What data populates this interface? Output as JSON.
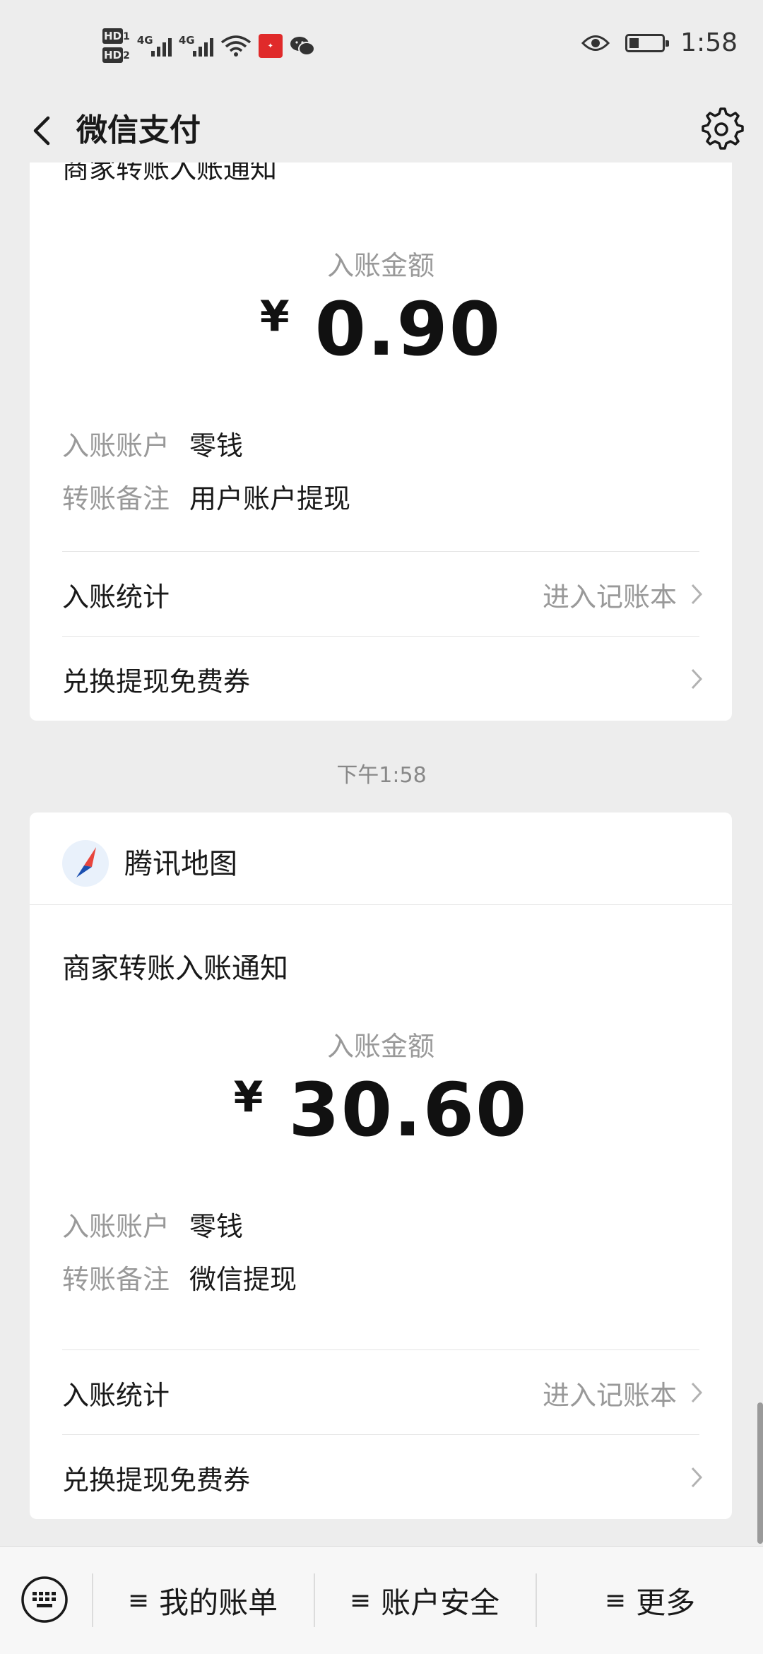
{
  "status_bar": {
    "hd1": "HD",
    "hd1_sub": "1",
    "hd2": "HD",
    "hd2_sub": "2",
    "net1": "4G",
    "net2": "4G",
    "time": "1:58",
    "battery_level": 0.3,
    "icons": [
      "hd-icon",
      "signal-icon",
      "wifi-icon",
      "notification-icon",
      "wechat-icon",
      "eye-icon",
      "battery-icon"
    ]
  },
  "nav": {
    "title": "微信支付"
  },
  "card1": {
    "title_cut": "商家转账入账通知",
    "amount_label": "入账金额",
    "currency": "¥",
    "amount": "0.90",
    "account_key": "入账账户",
    "account_value": "零钱",
    "remark_key": "转账备注",
    "remark_value": "用户账户提现",
    "stats_label": "入账统计",
    "stats_link": "进入记账本",
    "coupon_label": "兑换提现免费券"
  },
  "timestamp": "下午1:58",
  "card2": {
    "source_name": "腾讯地图",
    "title": "商家转账入账通知",
    "amount_label": "入账金额",
    "currency": "¥",
    "amount": "30.60",
    "account_key": "入账账户",
    "account_value": "零钱",
    "remark_key": "转账备注",
    "remark_value": "微信提现",
    "stats_label": "入账统计",
    "stats_link": "进入记账本",
    "coupon_label": "兑换提现免费券"
  },
  "bottom_menu": {
    "items": [
      {
        "label": "我的账单"
      },
      {
        "label": "账户安全"
      },
      {
        "label": "更多"
      }
    ],
    "hamburger": "≡"
  },
  "colors": {
    "background": "#ededed",
    "card": "#ffffff",
    "secondary_text": "#999999",
    "primary_text": "#191919"
  }
}
